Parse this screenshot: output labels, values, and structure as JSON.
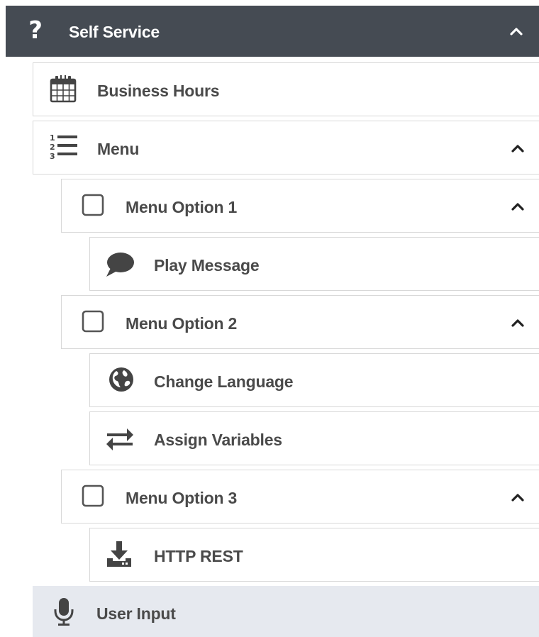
{
  "header": {
    "title": "Self Service",
    "icon": "question-mark-icon",
    "expanded": true
  },
  "items": [
    {
      "label": "Business Hours",
      "icon": "calendar-icon",
      "level": 1
    },
    {
      "label": "Menu",
      "icon": "numbered-list-icon",
      "level": 1,
      "expanded": true
    },
    {
      "label": "Menu Option 1",
      "icon": "checkbox-icon",
      "level": 2,
      "expanded": true
    },
    {
      "label": "Play Message",
      "icon": "speech-bubble-icon",
      "level": 3
    },
    {
      "label": "Menu Option 2",
      "icon": "checkbox-icon",
      "level": 2,
      "expanded": true
    },
    {
      "label": "Change Language",
      "icon": "globe-icon",
      "level": 3
    },
    {
      "label": "Assign Variables",
      "icon": "swap-arrows-icon",
      "level": 3
    },
    {
      "label": "Menu Option 3",
      "icon": "checkbox-icon",
      "level": 2,
      "expanded": true
    },
    {
      "label": "HTTP REST",
      "icon": "download-tray-icon",
      "level": 3
    },
    {
      "label": "User Input",
      "icon": "microphone-icon",
      "level": 1,
      "selected": true
    }
  ],
  "colors": {
    "header_bg": "#454b53",
    "text": "#4a4a4a",
    "border": "#d8d8d8",
    "selected_bg": "#e6e9ef"
  }
}
